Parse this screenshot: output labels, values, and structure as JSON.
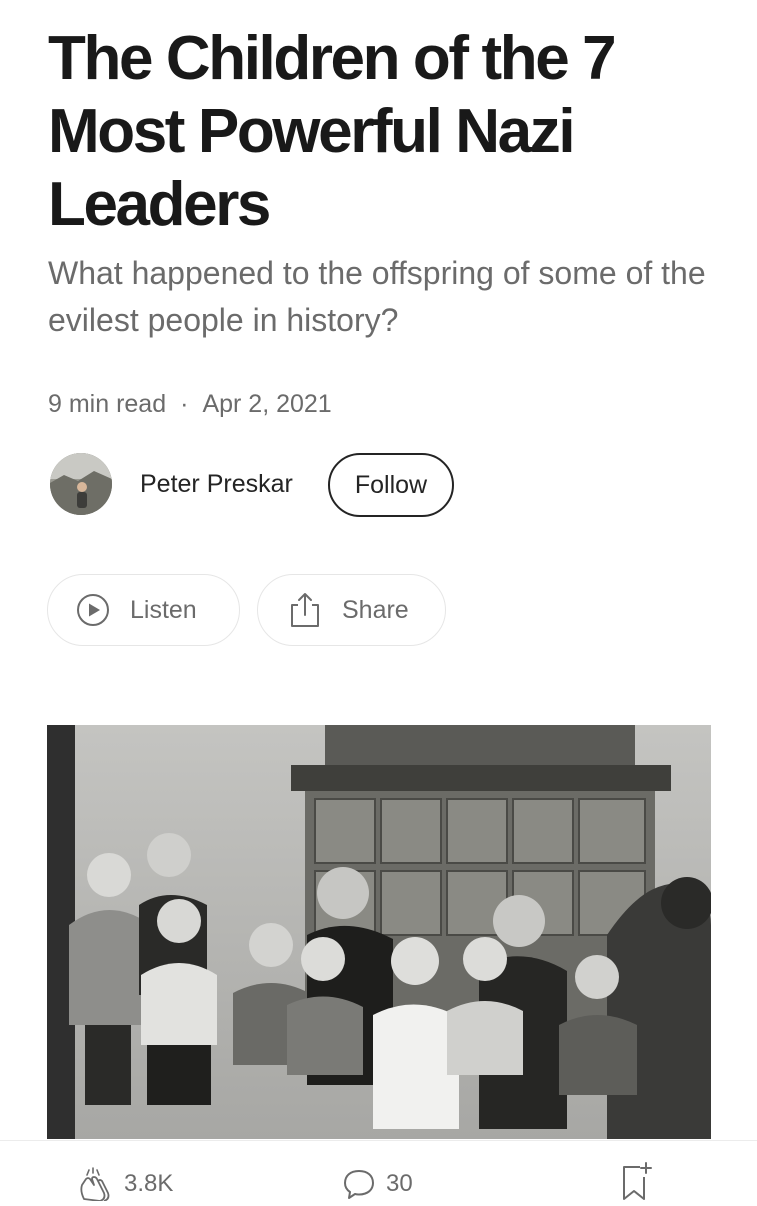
{
  "article": {
    "title": "The Children of the 7 Most Powerful Nazi Leaders",
    "subtitle": "What happened to the offspring of some of the evilest people in history?",
    "read_time": "9 min read",
    "separator": "·",
    "date": "Apr 2, 2021"
  },
  "author": {
    "name": "Peter Preskar",
    "follow_label": "Follow"
  },
  "actions": {
    "listen_label": "Listen",
    "share_label": "Share"
  },
  "icons": {
    "listen": "play-circle-icon",
    "share": "share-icon",
    "clap": "clap-icon",
    "responses": "speech-bubble-icon",
    "save": "bookmark-add-icon"
  },
  "engagement": {
    "claps": "3.8K",
    "responses": "30"
  },
  "colors": {
    "text_primary": "#242424",
    "text_secondary": "#6b6b6b",
    "pill_border": "#e6e6e6"
  }
}
